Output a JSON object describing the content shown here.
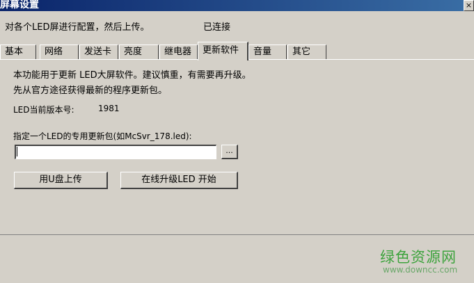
{
  "window": {
    "title": "屏幕设置",
    "close_label": "×"
  },
  "header": {
    "instruction": "对各个LED屏进行配置，然后上传。",
    "connection_status": "已连接"
  },
  "tabs": [
    {
      "label": "基本",
      "active": false
    },
    {
      "label": "网络",
      "active": false
    },
    {
      "label": "发送卡",
      "active": false
    },
    {
      "label": "亮度",
      "active": false
    },
    {
      "label": "继电器",
      "active": false
    },
    {
      "label": "更新软件",
      "active": true
    },
    {
      "label": "音量",
      "active": false
    },
    {
      "label": "其它",
      "active": false
    }
  ],
  "panel": {
    "description_line1": "本功能用于更新 LED大屏软件。建议慎重，有需要再升级。",
    "description_line2": "先从官方途径获得最新的程序更新包。",
    "version_label": "LED当前版本号:",
    "version_value": "1981",
    "package_label": "指定一个LED的专用更新包(如McSvr_178.led):",
    "package_path_value": "",
    "browse_label": "...",
    "usb_upload_label": "用U盘上传",
    "online_upgrade_label": "在线升级LED 开始"
  },
  "watermark": {
    "site_name": "绿色资源网",
    "site_url": "www.downcc.com"
  }
}
